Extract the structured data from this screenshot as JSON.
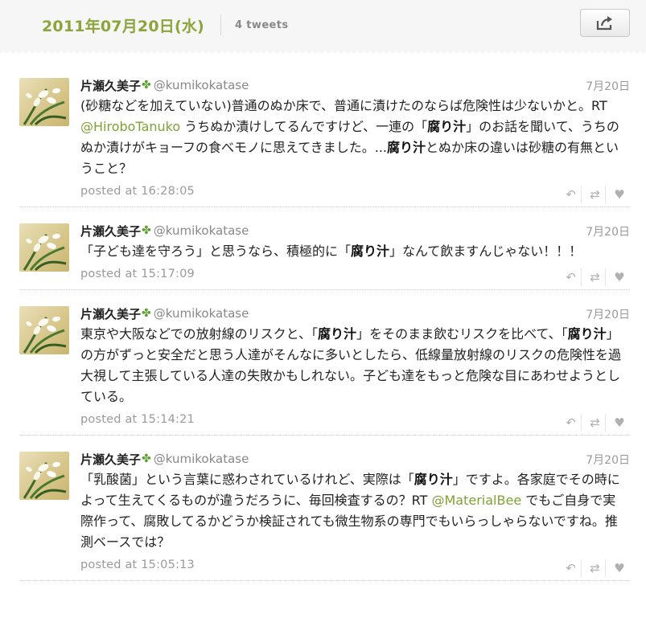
{
  "header": {
    "date": "2011年07月20日(水)",
    "count": "4 tweets",
    "share_icon": "share-icon"
  },
  "tweets": [
    {
      "name": "片瀬久美子",
      "handle": "@kumikokatase",
      "date": "7月20日",
      "time": "posted at 16:28:05",
      "parts": [
        {
          "t": "(砂糖などを加えていない)普通のぬか床で、普通に漬けたのならば危険性は少ないかと。RT "
        },
        {
          "m": "@HiroboTanuko"
        },
        {
          "t": " うちぬか漬けしてるんですけど、一連の「"
        },
        {
          "b": "腐り汁"
        },
        {
          "t": "」のお話を聞いて、うちのぬか漬けがキョーフの食べモノに思えてきました。..."
        },
        {
          "b": "腐り汁"
        },
        {
          "t": "とぬか床の違いは砂糖の有無ということ？"
        }
      ]
    },
    {
      "name": "片瀬久美子",
      "handle": "@kumikokatase",
      "date": "7月20日",
      "time": "posted at 15:17:09",
      "parts": [
        {
          "t": "「子ども達を守ろう」と思うなら、積極的に「"
        },
        {
          "b": "腐り汁"
        },
        {
          "t": "」なんて飲ますんじゃない！！！"
        }
      ]
    },
    {
      "name": "片瀬久美子",
      "handle": "@kumikokatase",
      "date": "7月20日",
      "time": "posted at 15:14:21",
      "parts": [
        {
          "t": "東京や大阪などでの放射線のリスクと、「"
        },
        {
          "b": "腐り汁"
        },
        {
          "t": "」をそのまま飲むリスクを比べて、「"
        },
        {
          "b": "腐り汁"
        },
        {
          "t": "」の方がずっと安全だと思う人達がそんなに多いとしたら、低線量放射線のリスクの危険性を過大視して主張している人達の失敗かもしれない。子ども達をもっと危険な目にあわせようとしている。"
        }
      ]
    },
    {
      "name": "片瀬久美子",
      "handle": "@kumikokatase",
      "date": "7月20日",
      "time": "posted at 15:05:13",
      "parts": [
        {
          "t": "「乳酸菌」という言葉に惑わされているけれど、実際は「"
        },
        {
          "b": "腐り汁"
        },
        {
          "t": "」ですよ。各家庭でその時によって生えてくるものが違うだろうに、毎回検査するの？RT "
        },
        {
          "m": "@MaterialBee"
        },
        {
          "t": " でもご自身で実際作って、腐敗してるかどうか検証されても微生物系の専門でもいらっしゃらないですね。推測ベースでは？"
        }
      ]
    }
  ],
  "icons": {
    "reply": "reply-icon",
    "retweet": "retweet-icon",
    "favorite": "heart-icon",
    "clover": "clover-icon"
  }
}
